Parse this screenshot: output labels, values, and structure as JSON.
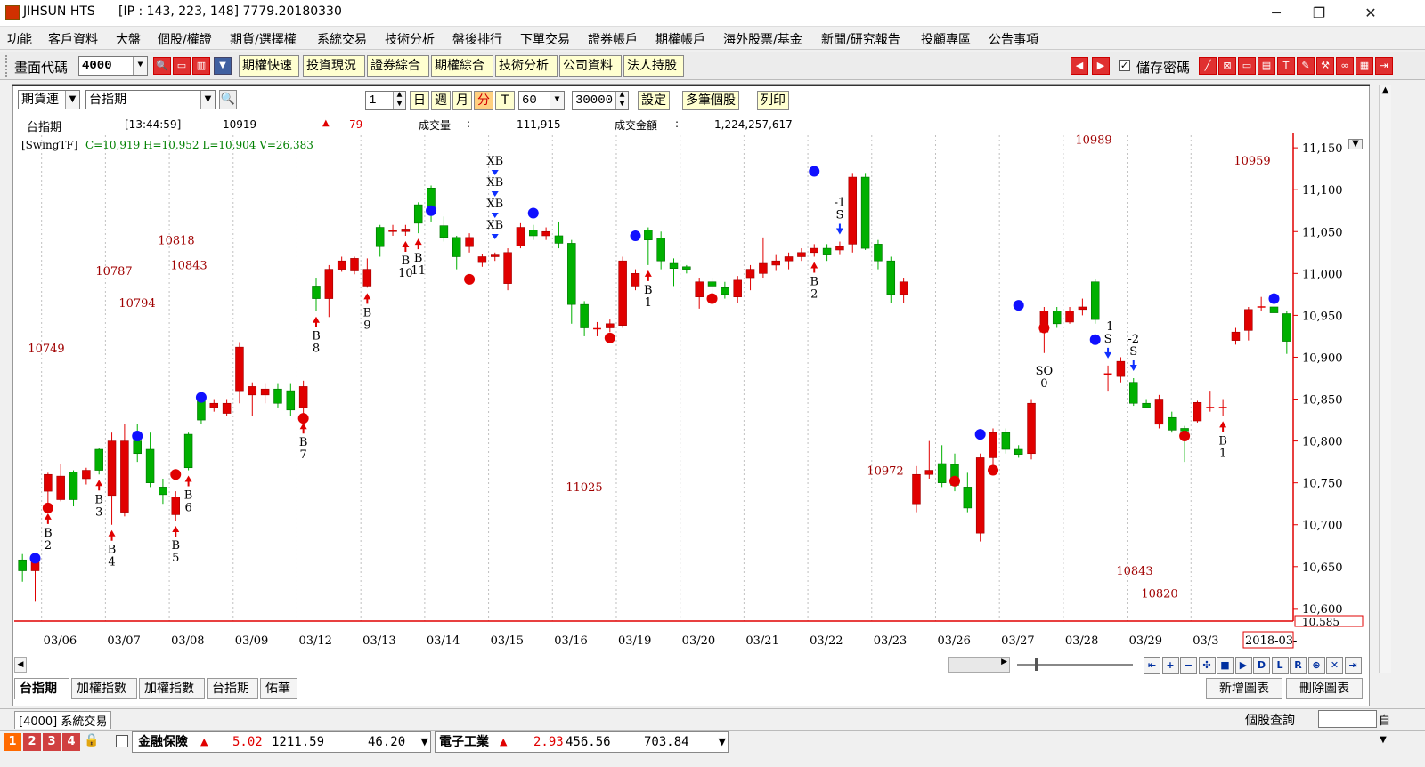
{
  "titlebar": {
    "app": "JIHSUN HTS",
    "ip": "[IP : 143, 223, 148] 7779.20180330",
    "minimize": "─",
    "restore": "❐",
    "close": "✕"
  },
  "menu": [
    "功能",
    "客戶資料",
    "大盤",
    "個股/權證",
    "期貨/選擇權",
    "系統交易",
    "技術分析",
    "盤後排行",
    "下單交易",
    "證券帳戶",
    "期權帳戶",
    "海外股票/基金",
    "新聞/研究報告",
    "投顧專區",
    "公告事項"
  ],
  "toolbar": {
    "code_label": "畫面代碼",
    "code_value": "4000",
    "buttons": [
      "期權快速",
      "投資現況",
      "證券綜合",
      "期權綜合",
      "技術分析",
      "公司資料",
      "法人持股"
    ],
    "save_password": "儲存密碼"
  },
  "chartbar": {
    "product_type": "期貨連",
    "product_name": "台指期",
    "period_count": "1",
    "periods": [
      "日",
      "週",
      "月",
      "分",
      "T"
    ],
    "minute_value": "60",
    "bars_value": "30000",
    "settings": "設定",
    "multi": "多筆個股",
    "print": "列印"
  },
  "quote": {
    "name": "台指期",
    "time": "[13:44:59]",
    "price": "10919",
    "change": "79",
    "volume_label": "成交量",
    "volume_sep": ":",
    "volume": "111,915",
    "amount_label": "成交金額",
    "amount_sep": ":",
    "amount": "1,224,257,617"
  },
  "indicator": {
    "name": "[SwingTF]",
    "values": "C=10,919 H=10,952 L=10,904 V=26,383"
  },
  "tabs": [
    "台指期",
    "加權指數",
    "加權指數",
    "台指期",
    "佑華"
  ],
  "right_buttons": [
    "新增圖表",
    "刪除圖表"
  ],
  "status": {
    "code": "[4000]",
    "title": "系統交易",
    "search": "個股查詢",
    "small": "自"
  },
  "bottom": {
    "nums": [
      "1",
      "2",
      "3",
      "4"
    ],
    "s1_name": "金融保險",
    "s1_pct": "5.02",
    "s1_price": "1211.59",
    "s1_vol": "46.20",
    "s2_name": "電子工業",
    "s2_pct": "2.93",
    "s2_price": "456.56",
    "s2_vol": "703.84"
  },
  "chart_data": {
    "type": "candlestick",
    "ylim": [
      10585,
      11165
    ],
    "y_ticks": [
      11150,
      11100,
      11050,
      11000,
      10950,
      10900,
      10850,
      10800,
      10750,
      10700,
      10650,
      10600
    ],
    "y_tick_labels": [
      "11,150",
      "11,100",
      "11,050",
      "11,000",
      "10,950",
      "10,900",
      "10,850",
      "10,800",
      "10,750",
      "10,700",
      "10,650",
      "10,600"
    ],
    "current_label": "10,585",
    "x_labels": [
      "03/06",
      "03/07",
      "03/08",
      "03/09",
      "03/12",
      "03/13",
      "03/14",
      "03/15",
      "03/16",
      "03/19",
      "03/20",
      "03/21",
      "03/22",
      "03/23",
      "03/26",
      "03/27",
      "03/28",
      "03/29",
      "03/3"
    ],
    "x_last_label": "2018-03-",
    "candles": [
      {
        "o": 10658,
        "c": 10645,
        "h": 10665,
        "l": 10632
      },
      {
        "o": 10645,
        "c": 10658,
        "h": 10660,
        "l": 10608
      },
      {
        "o": 10740,
        "c": 10760,
        "h": 10762,
        "l": 10720
      },
      {
        "o": 10730,
        "c": 10758,
        "h": 10772,
        "l": 10728
      },
      {
        "o": 10763,
        "c": 10730,
        "h": 10765,
        "l": 10722
      },
      {
        "o": 10755,
        "c": 10765,
        "h": 10768,
        "l": 10748
      },
      {
        "o": 10790,
        "c": 10765,
        "h": 10792,
        "l": 10760
      },
      {
        "o": 10735,
        "c": 10800,
        "h": 10810,
        "l": 10700
      },
      {
        "o": 10715,
        "c": 10800,
        "h": 10820,
        "l": 10710
      },
      {
        "o": 10800,
        "c": 10785,
        "h": 10820,
        "l": 10775
      },
      {
        "o": 10790,
        "c": 10750,
        "h": 10810,
        "l": 10745
      },
      {
        "o": 10745,
        "c": 10736,
        "h": 10755,
        "l": 10725
      },
      {
        "o": 10712,
        "c": 10733,
        "h": 10740,
        "l": 10705
      },
      {
        "o": 10808,
        "c": 10768,
        "h": 10810,
        "l": 10765
      },
      {
        "o": 10848,
        "c": 10825,
        "h": 10850,
        "l": 10820
      },
      {
        "o": 10840,
        "c": 10845,
        "h": 10850,
        "l": 10835
      },
      {
        "o": 10833,
        "c": 10845,
        "h": 10850,
        "l": 10830
      },
      {
        "o": 10860,
        "c": 10912,
        "h": 10918,
        "l": 10845
      },
      {
        "o": 10855,
        "c": 10865,
        "h": 10870,
        "l": 10830
      },
      {
        "o": 10855,
        "c": 10862,
        "h": 10868,
        "l": 10845
      },
      {
        "o": 10862,
        "c": 10845,
        "h": 10868,
        "l": 10840
      },
      {
        "o": 10860,
        "c": 10837,
        "h": 10868,
        "l": 10830
      },
      {
        "o": 10840,
        "c": 10865,
        "h": 10872,
        "l": 10828
      },
      {
        "o": 10985,
        "c": 10970,
        "h": 10995,
        "l": 10955
      },
      {
        "o": 10970,
        "c": 11005,
        "h": 11010,
        "l": 10948
      },
      {
        "o": 11005,
        "c": 11015,
        "h": 11020,
        "l": 11002
      },
      {
        "o": 11003,
        "c": 11018,
        "h": 11020,
        "l": 10999
      },
      {
        "o": 10985,
        "c": 11005,
        "h": 11018,
        "l": 10983
      },
      {
        "o": 11055,
        "c": 11032,
        "h": 11058,
        "l": 11020
      },
      {
        "o": 11050,
        "c": 11052,
        "h": 11058,
        "l": 11045
      },
      {
        "o": 11050,
        "c": 11053,
        "h": 11058,
        "l": 11045
      },
      {
        "o": 11082,
        "c": 11060,
        "h": 11085,
        "l": 11048
      },
      {
        "o": 11102,
        "c": 11075,
        "h": 11105,
        "l": 11062
      },
      {
        "o": 11057,
        "c": 11043,
        "h": 11068,
        "l": 11038
      },
      {
        "o": 11043,
        "c": 11020,
        "h": 11045,
        "l": 11005
      },
      {
        "o": 11032,
        "c": 11043,
        "h": 11048,
        "l": 11025
      },
      {
        "o": 11013,
        "c": 11020,
        "h": 11023,
        "l": 11008
      },
      {
        "o": 11020,
        "c": 11022,
        "h": 11025,
        "l": 11015
      },
      {
        "o": 10988,
        "c": 11025,
        "h": 11030,
        "l": 10980
      },
      {
        "o": 11033,
        "c": 11055,
        "h": 11060,
        "l": 11030
      },
      {
        "o": 11052,
        "c": 11045,
        "h": 11058,
        "l": 11040
      },
      {
        "o": 11045,
        "c": 11050,
        "h": 11055,
        "l": 11040
      },
      {
        "o": 11045,
        "c": 11036,
        "h": 11062,
        "l": 11030
      },
      {
        "o": 11036,
        "c": 10963,
        "h": 11040,
        "l": 10940
      },
      {
        "o": 10963,
        "c": 10935,
        "h": 10967,
        "l": 10925
      },
      {
        "o": 10934,
        "c": 10934,
        "h": 10942,
        "l": 10925
      },
      {
        "o": 10935,
        "c": 10940,
        "h": 10945,
        "l": 10930
      },
      {
        "o": 10938,
        "c": 11015,
        "h": 11020,
        "l": 10935
      },
      {
        "o": 10985,
        "c": 11000,
        "h": 11005,
        "l": 10980
      },
      {
        "o": 11052,
        "c": 11040,
        "h": 11055,
        "l": 11010
      },
      {
        "o": 11042,
        "c": 11015,
        "h": 11050,
        "l": 11005
      },
      {
        "o": 11012,
        "c": 11006,
        "h": 11018,
        "l": 10985
      },
      {
        "o": 11008,
        "c": 11005,
        "h": 11010,
        "l": 11000
      },
      {
        "o": 10972,
        "c": 10990,
        "h": 10995,
        "l": 10958
      },
      {
        "o": 10990,
        "c": 10985,
        "h": 10995,
        "l": 10975
      },
      {
        "o": 10983,
        "c": 10975,
        "h": 10990,
        "l": 10970
      },
      {
        "o": 10972,
        "c": 10992,
        "h": 10997,
        "l": 10965
      },
      {
        "o": 10995,
        "c": 11005,
        "h": 11010,
        "l": 10980
      },
      {
        "o": 11000,
        "c": 11012,
        "h": 11043,
        "l": 10995
      },
      {
        "o": 11010,
        "c": 11015,
        "h": 11022,
        "l": 11003
      },
      {
        "o": 11015,
        "c": 11020,
        "h": 11025,
        "l": 11005
      },
      {
        "o": 11020,
        "c": 11025,
        "h": 11030,
        "l": 11015
      },
      {
        "o": 11025,
        "c": 11030,
        "h": 11035,
        "l": 11020
      },
      {
        "o": 11030,
        "c": 11022,
        "h": 11035,
        "l": 11015
      },
      {
        "o": 11028,
        "c": 11032,
        "h": 11038,
        "l": 11022
      },
      {
        "o": 11035,
        "c": 11115,
        "h": 11120,
        "l": 11025
      },
      {
        "o": 11115,
        "c": 11030,
        "h": 11120,
        "l": 11028
      },
      {
        "o": 11035,
        "c": 11015,
        "h": 11040,
        "l": 11005
      },
      {
        "o": 11015,
        "c": 10975,
        "h": 11020,
        "l": 10965
      },
      {
        "o": 10975,
        "c": 10990,
        "h": 10995,
        "l": 10965
      },
      {
        "o": 10725,
        "c": 10760,
        "h": 10770,
        "l": 10715
      },
      {
        "o": 10760,
        "c": 10765,
        "h": 10800,
        "l": 10755
      },
      {
        "o": 10773,
        "c": 10750,
        "h": 10795,
        "l": 10745
      },
      {
        "o": 10772,
        "c": 10747,
        "h": 10785,
        "l": 10740
      },
      {
        "o": 10745,
        "c": 10720,
        "h": 10762,
        "l": 10715
      },
      {
        "o": 10690,
        "c": 10780,
        "h": 10785,
        "l": 10680
      },
      {
        "o": 10780,
        "c": 10810,
        "h": 10815,
        "l": 10770
      },
      {
        "o": 10810,
        "c": 10790,
        "h": 10815,
        "l": 10785
      },
      {
        "o": 10790,
        "c": 10784,
        "h": 10795,
        "l": 10780
      },
      {
        "o": 10785,
        "c": 10845,
        "h": 10850,
        "l": 10778
      },
      {
        "o": 10930,
        "c": 10955,
        "h": 10960,
        "l": 10905
      },
      {
        "o": 10955,
        "c": 10940,
        "h": 10960,
        "l": 10935
      },
      {
        "o": 10942,
        "c": 10955,
        "h": 10960,
        "l": 10940
      },
      {
        "o": 10957,
        "c": 10960,
        "h": 10970,
        "l": 10950
      },
      {
        "o": 10990,
        "c": 10945,
        "h": 10993,
        "l": 10940
      },
      {
        "o": 10880,
        "c": 10880,
        "h": 10890,
        "l": 10860
      },
      {
        "o": 10877,
        "c": 10895,
        "h": 10900,
        "l": 10870
      },
      {
        "o": 10870,
        "c": 10845,
        "h": 10875,
        "l": 10842
      },
      {
        "o": 10845,
        "c": 10840,
        "h": 10850,
        "l": 10840
      },
      {
        "o": 10820,
        "c": 10850,
        "h": 10855,
        "l": 10815
      },
      {
        "o": 10828,
        "c": 10813,
        "h": 10835,
        "l": 10810
      },
      {
        "o": 10815,
        "c": 10812,
        "h": 10818,
        "l": 10775
      },
      {
        "o": 10824,
        "c": 10846,
        "h": 10848,
        "l": 10822
      },
      {
        "o": 10840,
        "c": 10840,
        "h": 10860,
        "l": 10835
      },
      {
        "o": 10840,
        "c": 10840,
        "h": 10850,
        "l": 10830
      },
      {
        "o": 10920,
        "c": 10930,
        "h": 10935,
        "l": 10915
      },
      {
        "o": 10932,
        "c": 10957,
        "h": 10960,
        "l": 10920
      },
      {
        "o": 10960,
        "c": 10960,
        "h": 10972,
        "l": 10955
      },
      {
        "o": 10960,
        "c": 10953,
        "h": 10965,
        "l": 10950
      },
      {
        "o": 10952,
        "c": 10919,
        "h": 10955,
        "l": 10904
      }
    ],
    "blue_dots": [
      {
        "i": 1,
        "v": 10660
      },
      {
        "i": 14,
        "v": 10852
      },
      {
        "i": 9,
        "v": 10806
      },
      {
        "i": 32,
        "v": 11075
      },
      {
        "i": 40,
        "v": 11072
      },
      {
        "i": 48,
        "v": 11045
      },
      {
        "i": 62,
        "v": 11122
      },
      {
        "i": 75,
        "v": 10808
      },
      {
        "i": 78,
        "v": 10962
      },
      {
        "i": 84,
        "v": 10921
      },
      {
        "i": 98,
        "v": 10970
      }
    ],
    "red_dots": [
      {
        "i": 2,
        "v": 10720
      },
      {
        "i": 12,
        "v": 10760
      },
      {
        "i": 22,
        "v": 10827
      },
      {
        "i": 35,
        "v": 10993
      },
      {
        "i": 46,
        "v": 10923
      },
      {
        "i": 54,
        "v": 10970
      },
      {
        "i": 73,
        "v": 10752
      },
      {
        "i": 76,
        "v": 10765
      },
      {
        "i": 80,
        "v": 10935
      },
      {
        "i": 91,
        "v": 10806
      }
    ],
    "signals": [
      {
        "i": 2,
        "dir": "B",
        "label": "2"
      },
      {
        "i": 6,
        "dir": "B",
        "label": "3"
      },
      {
        "i": 7,
        "dir": "B",
        "label": "4"
      },
      {
        "i": 12,
        "dir": "B",
        "label": "5"
      },
      {
        "i": 13,
        "dir": "B",
        "label": "6"
      },
      {
        "i": 22,
        "dir": "B",
        "label": "7"
      },
      {
        "i": 23,
        "dir": "B",
        "label": "8"
      },
      {
        "i": 27,
        "dir": "B",
        "label": "9"
      },
      {
        "i": 30,
        "dir": "B",
        "label": "10"
      },
      {
        "i": 31,
        "dir": "B",
        "label": "11"
      },
      {
        "i": 49,
        "dir": "B",
        "label": "1"
      },
      {
        "i": 62,
        "dir": "B",
        "label": "2"
      },
      {
        "i": 94,
        "dir": "B",
        "label": "1"
      }
    ],
    "sell_signals": [
      {
        "i": 64,
        "top": "-1",
        "bottom": "S"
      },
      {
        "i": 85,
        "top": "-1",
        "bottom": "S"
      },
      {
        "i": 87,
        "top": "-2",
        "bottom": "S"
      }
    ],
    "so_label": {
      "i": 80,
      "top": "SO",
      "bottom": "0"
    },
    "xb_stack": [
      "XB",
      "XB",
      "XB",
      "XB"
    ],
    "annotations": [
      "10749",
      "10787",
      "10794",
      "10818",
      "10843",
      "11025",
      "10972",
      "10989",
      "10843",
      "10820",
      "10959"
    ]
  }
}
